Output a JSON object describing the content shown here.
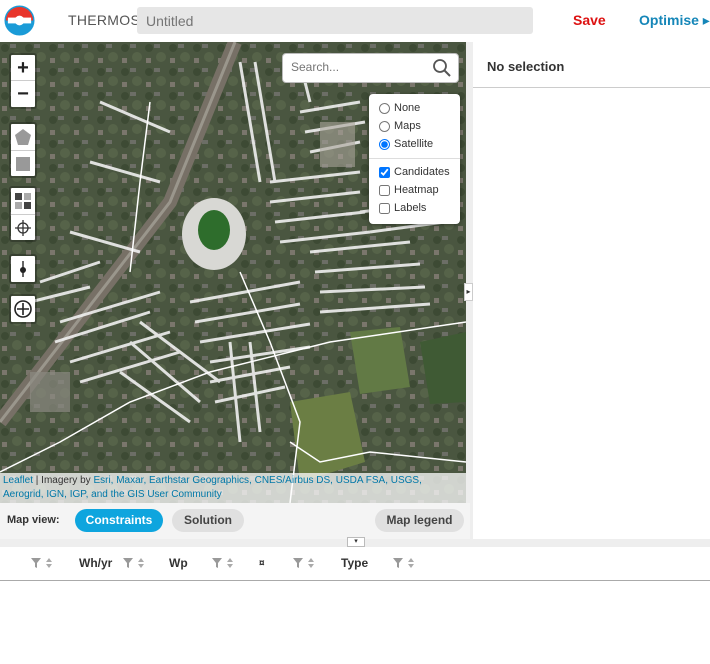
{
  "app": {
    "name": "THERMOS",
    "title_placeholder": "Untitled"
  },
  "toolbar": {
    "save_label": "Save",
    "optimise_label": "Optimise ▸"
  },
  "map": {
    "zoom_in": "+",
    "zoom_out": "−",
    "search_placeholder": "Search...",
    "layers": {
      "basemap_options": [
        {
          "label": "None",
          "checked": false
        },
        {
          "label": "Maps",
          "checked": false
        },
        {
          "label": "Satellite",
          "checked": true
        }
      ],
      "overlays": [
        {
          "label": "Candidates",
          "checked": true
        },
        {
          "label": "Heatmap",
          "checked": false
        },
        {
          "label": "Labels",
          "checked": false
        }
      ]
    },
    "attribution": {
      "leaflet": "Leaflet",
      "separator": " | Imagery by ",
      "providers": "Esri, Maxar, Earthstar Geographics, CNES/Airbus DS, USDA FSA, USGS, Aerogrid, IGN, IGP, and the GIS User Community"
    }
  },
  "map_view": {
    "label": "Map view:",
    "constraints": "Constraints",
    "solution": "Solution",
    "legend": "Map legend"
  },
  "selection_panel": {
    "title": "No selection"
  },
  "table": {
    "columns": [
      "",
      "Wh/yr",
      "Wp",
      "¤",
      "Type"
    ]
  },
  "colors": {
    "accent": "#0ea5de",
    "save": "#dd1111",
    "optimise": "#1586b8"
  }
}
